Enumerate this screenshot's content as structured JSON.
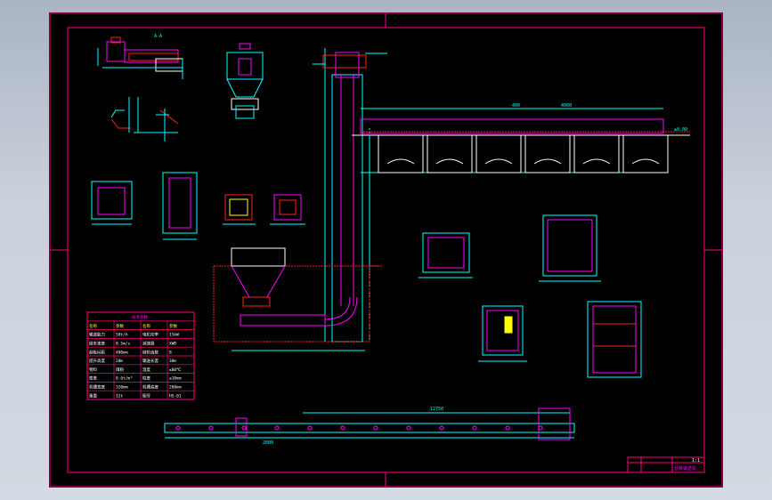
{
  "drawing": {
    "colors": {
      "background": "#000000",
      "frame": "#ff0080",
      "dimension": "#00ffff",
      "outline": "#ff00ff",
      "red": "#ff2020",
      "yellow": "#ffff00",
      "white": "#ffffff",
      "blue": "#3050ff",
      "viewport": "#c9d1dc"
    },
    "labels": {
      "section_a": "A-A",
      "dim_conveyor_top": "400",
      "dim_conveyor_mid": "4000",
      "dim_bottom_total": "12750",
      "dim_bottom_seg": "2000",
      "scale": "1:1",
      "level_mark": "±0.00",
      "title_cell": "刮板输送机",
      "table_title": "技术参数",
      "table_header": [
        "名称",
        "参数",
        "名称",
        "参数"
      ],
      "table_rows": [
        [
          "输送能力",
          "50t/h",
          "电机功率",
          "15kW"
        ],
        [
          "链条速度",
          "0.5m/s",
          "减速器",
          "XWD"
        ],
        [
          "刮板间距",
          "400mm",
          "链轮齿数",
          "8"
        ],
        [
          "提升高度",
          "20m",
          "输送长度",
          "30m"
        ],
        [
          "物料",
          "煤粉",
          "温度",
          "≤80℃"
        ],
        [
          "密度",
          "0.6t/m³",
          "粒度",
          "≤10mm"
        ],
        [
          "机槽宽度",
          "320mm",
          "机槽高度",
          "260mm"
        ],
        [
          "重量",
          "12t",
          "图号",
          "HS-01"
        ]
      ]
    }
  }
}
